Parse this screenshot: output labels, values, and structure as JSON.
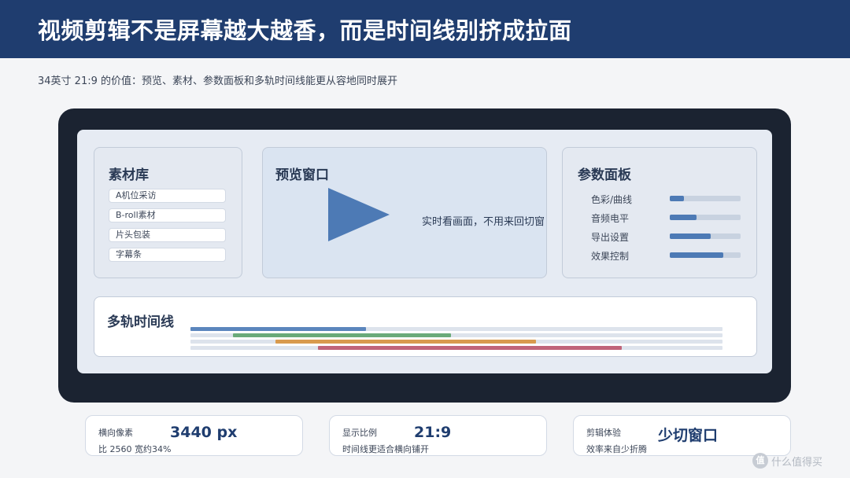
{
  "header": {
    "title": "视频剪辑不是屏幕越大越香，而是时间线别挤成拉面"
  },
  "subtitle": "34英寸 21:9 的价值：预览、素材、参数面板和多轨时间线能更从容地同时展开",
  "screen": {
    "assets": {
      "title": "素材库",
      "items": [
        "A机位采访",
        "B-roll素材",
        "片头包装",
        "字幕条"
      ]
    },
    "preview": {
      "title": "预览窗口",
      "play_icon": "play-icon",
      "caption": "实时看画面，不用来回切窗"
    },
    "params": {
      "title": "参数面板",
      "items": [
        {
          "label": "色彩/曲线",
          "level": 0.2
        },
        {
          "label": "音频电平",
          "level": 0.38
        },
        {
          "label": "导出设置",
          "level": 0.58
        },
        {
          "label": "效果控制",
          "level": 0.76
        }
      ]
    },
    "timeline": {
      "title": "多轨时间线",
      "tracks": [
        {
          "start": 0.0,
          "end": 0.33,
          "color": "#5b86bd"
        },
        {
          "start": 0.08,
          "end": 0.49,
          "color": "#6aaa79"
        },
        {
          "start": 0.16,
          "end": 0.65,
          "color": "#d89a4e"
        },
        {
          "start": 0.24,
          "end": 0.81,
          "color": "#c06479"
        }
      ]
    }
  },
  "cards": [
    {
      "label": "横向像素",
      "value": "3440 px",
      "note": "比 2560 宽约34%"
    },
    {
      "label": "显示比例",
      "value": "21:9",
      "note": "时间线更适合横向铺开"
    },
    {
      "label": "剪辑体验",
      "value": "少切窗口",
      "note": "效率来自少折腾"
    }
  ],
  "watermark": {
    "icon": "zhi-logo-icon",
    "logo": "值",
    "text": "什么值得买"
  },
  "colors": {
    "header": "#1f3d6f",
    "accent": "#4d7ab5",
    "monitor": "#1b2331"
  }
}
